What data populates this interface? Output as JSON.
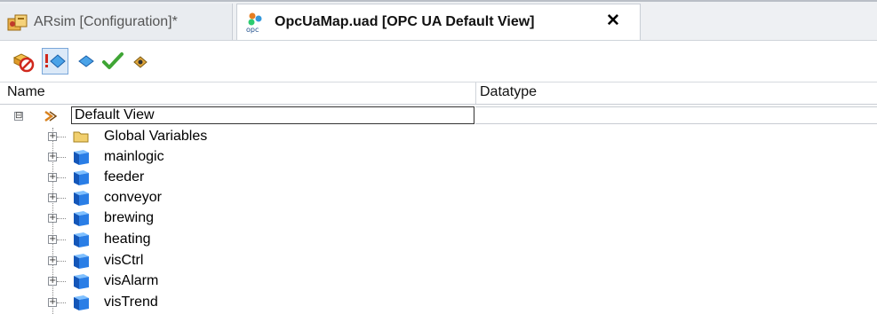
{
  "tabs": [
    {
      "label": "ARsim [Configuration]*",
      "icon": "project-icon",
      "active": false
    },
    {
      "label": "OpcUaMap.uad [OPC UA Default View]",
      "icon": "opc-map-icon",
      "active": true,
      "close": "✕"
    }
  ],
  "toolbar": {
    "buttons": [
      {
        "name": "disable-icon",
        "pressed": false
      },
      {
        "name": "enable-tag-icon",
        "pressed": true
      },
      {
        "name": "diamond-icon",
        "pressed": false
      },
      {
        "name": "check-icon",
        "pressed": false
      },
      {
        "name": "wand-icon",
        "pressed": false
      }
    ]
  },
  "columns": {
    "name": "Name",
    "datatype": "Datatype"
  },
  "tree": {
    "root": {
      "label": "Default View",
      "expander": "⊟"
    },
    "children": [
      {
        "label": "Global Variables",
        "icon": "folder-icon"
      },
      {
        "label": "mainlogic",
        "icon": "task-cube-icon"
      },
      {
        "label": "feeder",
        "icon": "task-cube-icon"
      },
      {
        "label": "conveyor",
        "icon": "task-cube-icon"
      },
      {
        "label": "brewing",
        "icon": "task-cube-icon"
      },
      {
        "label": "heating",
        "icon": "task-cube-icon"
      },
      {
        "label": "visCtrl",
        "icon": "task-cube-icon"
      },
      {
        "label": "visAlarm",
        "icon": "task-cube-icon"
      },
      {
        "label": "visTrend",
        "icon": "task-cube-icon"
      }
    ]
  },
  "colors": {
    "accent": "#7aa7d9",
    "cube": "#1e6fd0",
    "folder": "#e9c46a"
  }
}
